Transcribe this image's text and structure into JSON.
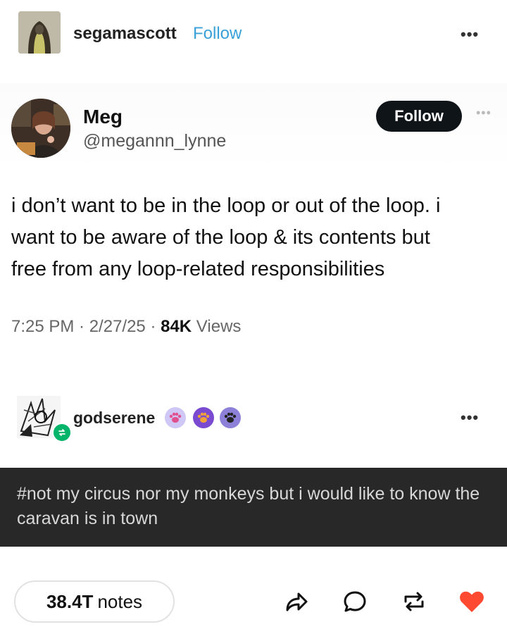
{
  "post": {
    "username": "segamascott",
    "follow_label": "Follow",
    "more_label": "•••"
  },
  "tweet": {
    "display_name": "Meg",
    "handle": "@megannn_lynne",
    "follow_label": "Follow",
    "more_label": "•••",
    "text": "i don’t want to be in the loop or out of the loop. i\nwant to be aware of the loop & its contents but\nfree from any loop-related responsibilities",
    "time": "7:25 PM · 2/27/25 · ",
    "views_count": "84K",
    "views_label": " Views"
  },
  "reblog": {
    "username": "godserene",
    "more_label": "•••",
    "badge_icons": [
      "paw-badge-icon",
      "paw-badge-icon",
      "paw-badge-icon"
    ]
  },
  "tags": {
    "text": "#not my circus nor my monkeys but i would like to know the caravan is in town"
  },
  "footer": {
    "notes_count": "38.4T",
    "notes_label": "notes",
    "actions": [
      "share-icon",
      "reply-icon",
      "reblog-icon",
      "like-icon"
    ],
    "like_color": "#ff4930",
    "accent_color": "#3aa0d8",
    "reblog_badge_color": "#00b46a"
  }
}
